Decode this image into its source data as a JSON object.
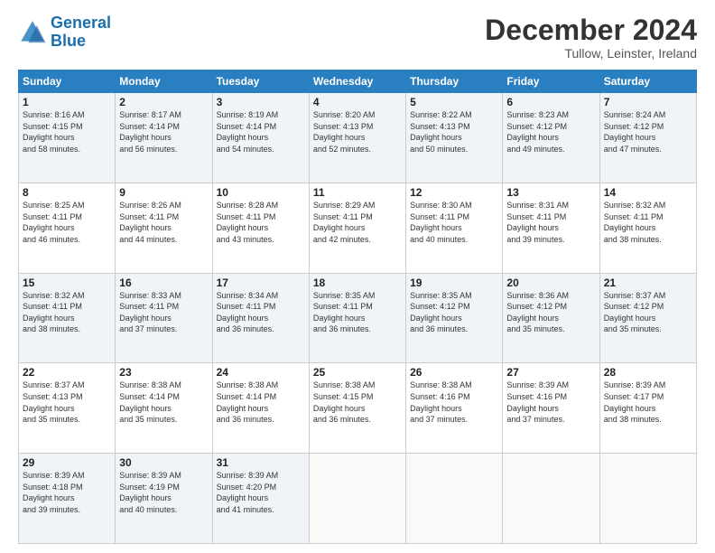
{
  "header": {
    "logo_line1": "General",
    "logo_line2": "Blue",
    "month_title": "December 2024",
    "location": "Tullow, Leinster, Ireland"
  },
  "days_of_week": [
    "Sunday",
    "Monday",
    "Tuesday",
    "Wednesday",
    "Thursday",
    "Friday",
    "Saturday"
  ],
  "weeks": [
    [
      {
        "day": "1",
        "sunrise": "8:16 AM",
        "sunset": "4:15 PM",
        "daylight": "7 hours and 58 minutes."
      },
      {
        "day": "2",
        "sunrise": "8:17 AM",
        "sunset": "4:14 PM",
        "daylight": "7 hours and 56 minutes."
      },
      {
        "day": "3",
        "sunrise": "8:19 AM",
        "sunset": "4:14 PM",
        "daylight": "7 hours and 54 minutes."
      },
      {
        "day": "4",
        "sunrise": "8:20 AM",
        "sunset": "4:13 PM",
        "daylight": "7 hours and 52 minutes."
      },
      {
        "day": "5",
        "sunrise": "8:22 AM",
        "sunset": "4:13 PM",
        "daylight": "7 hours and 50 minutes."
      },
      {
        "day": "6",
        "sunrise": "8:23 AM",
        "sunset": "4:12 PM",
        "daylight": "7 hours and 49 minutes."
      },
      {
        "day": "7",
        "sunrise": "8:24 AM",
        "sunset": "4:12 PM",
        "daylight": "7 hours and 47 minutes."
      }
    ],
    [
      {
        "day": "8",
        "sunrise": "8:25 AM",
        "sunset": "4:11 PM",
        "daylight": "7 hours and 46 minutes."
      },
      {
        "day": "9",
        "sunrise": "8:26 AM",
        "sunset": "4:11 PM",
        "daylight": "7 hours and 44 minutes."
      },
      {
        "day": "10",
        "sunrise": "8:28 AM",
        "sunset": "4:11 PM",
        "daylight": "7 hours and 43 minutes."
      },
      {
        "day": "11",
        "sunrise": "8:29 AM",
        "sunset": "4:11 PM",
        "daylight": "7 hours and 42 minutes."
      },
      {
        "day": "12",
        "sunrise": "8:30 AM",
        "sunset": "4:11 PM",
        "daylight": "7 hours and 40 minutes."
      },
      {
        "day": "13",
        "sunrise": "8:31 AM",
        "sunset": "4:11 PM",
        "daylight": "7 hours and 39 minutes."
      },
      {
        "day": "14",
        "sunrise": "8:32 AM",
        "sunset": "4:11 PM",
        "daylight": "7 hours and 38 minutes."
      }
    ],
    [
      {
        "day": "15",
        "sunrise": "8:32 AM",
        "sunset": "4:11 PM",
        "daylight": "7 hours and 38 minutes."
      },
      {
        "day": "16",
        "sunrise": "8:33 AM",
        "sunset": "4:11 PM",
        "daylight": "7 hours and 37 minutes."
      },
      {
        "day": "17",
        "sunrise": "8:34 AM",
        "sunset": "4:11 PM",
        "daylight": "7 hours and 36 minutes."
      },
      {
        "day": "18",
        "sunrise": "8:35 AM",
        "sunset": "4:11 PM",
        "daylight": "7 hours and 36 minutes."
      },
      {
        "day": "19",
        "sunrise": "8:35 AM",
        "sunset": "4:12 PM",
        "daylight": "7 hours and 36 minutes."
      },
      {
        "day": "20",
        "sunrise": "8:36 AM",
        "sunset": "4:12 PM",
        "daylight": "7 hours and 35 minutes."
      },
      {
        "day": "21",
        "sunrise": "8:37 AM",
        "sunset": "4:12 PM",
        "daylight": "7 hours and 35 minutes."
      }
    ],
    [
      {
        "day": "22",
        "sunrise": "8:37 AM",
        "sunset": "4:13 PM",
        "daylight": "7 hours and 35 minutes."
      },
      {
        "day": "23",
        "sunrise": "8:38 AM",
        "sunset": "4:14 PM",
        "daylight": "7 hours and 35 minutes."
      },
      {
        "day": "24",
        "sunrise": "8:38 AM",
        "sunset": "4:14 PM",
        "daylight": "7 hours and 36 minutes."
      },
      {
        "day": "25",
        "sunrise": "8:38 AM",
        "sunset": "4:15 PM",
        "daylight": "7 hours and 36 minutes."
      },
      {
        "day": "26",
        "sunrise": "8:38 AM",
        "sunset": "4:16 PM",
        "daylight": "7 hours and 37 minutes."
      },
      {
        "day": "27",
        "sunrise": "8:39 AM",
        "sunset": "4:16 PM",
        "daylight": "7 hours and 37 minutes."
      },
      {
        "day": "28",
        "sunrise": "8:39 AM",
        "sunset": "4:17 PM",
        "daylight": "7 hours and 38 minutes."
      }
    ],
    [
      {
        "day": "29",
        "sunrise": "8:39 AM",
        "sunset": "4:18 PM",
        "daylight": "7 hours and 39 minutes."
      },
      {
        "day": "30",
        "sunrise": "8:39 AM",
        "sunset": "4:19 PM",
        "daylight": "7 hours and 40 minutes."
      },
      {
        "day": "31",
        "sunrise": "8:39 AM",
        "sunset": "4:20 PM",
        "daylight": "7 hours and 41 minutes."
      },
      null,
      null,
      null,
      null
    ]
  ]
}
